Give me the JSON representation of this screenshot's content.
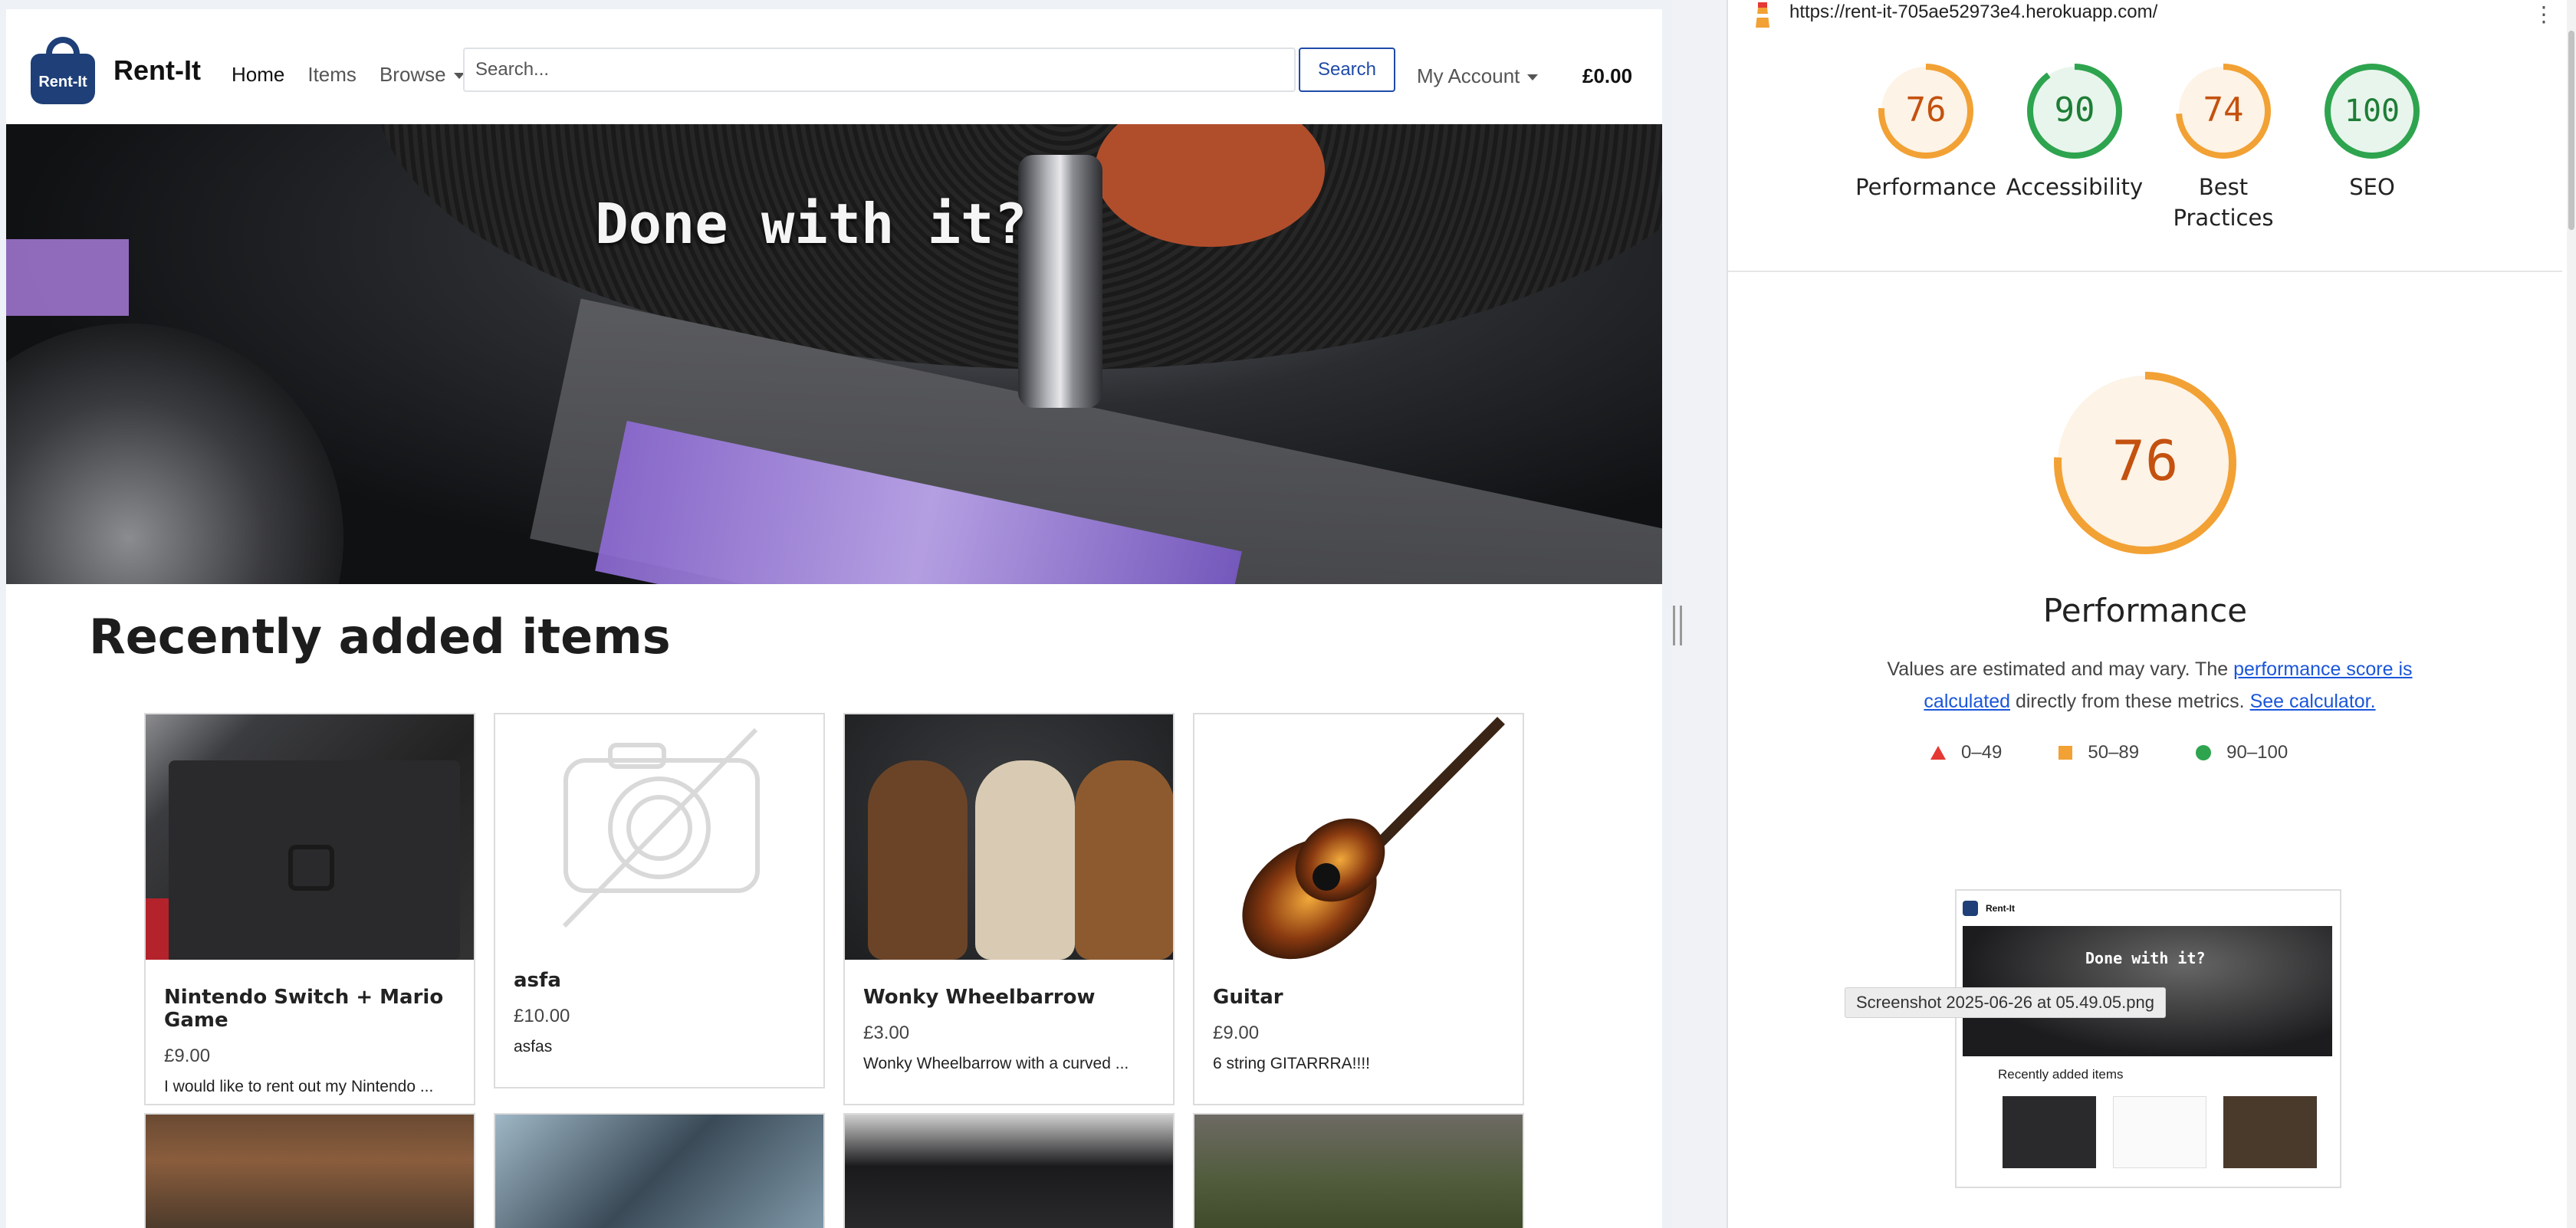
{
  "site": {
    "brand": {
      "logo_text": "Rent-It",
      "name": "Rent-It"
    },
    "nav": {
      "home": "Home",
      "items": "Items",
      "browse": "Browse"
    },
    "search": {
      "placeholder": "Search...",
      "button": "Search"
    },
    "account": "My Account",
    "cart_total": "£0.00",
    "hero_text": "Done with it?",
    "section_title": "Recently added items",
    "items": [
      {
        "name": "Nintendo Switch + Mario Game",
        "price": "£9.00",
        "desc": "I would like to rent out my Nintendo ..."
      },
      {
        "name": "asfa",
        "price": "£10.00",
        "desc": "asfas"
      },
      {
        "name": "Wonky Wheelbarrow",
        "price": "£3.00",
        "desc": "Wonky Wheelbarrow with a curved ..."
      },
      {
        "name": "Guitar",
        "price": "£9.00",
        "desc": "6 string GITARRRA!!!!"
      }
    ]
  },
  "lighthouse": {
    "url": "https://rent-it-705ae52973e4.herokuapp.com/",
    "scores": [
      {
        "label": "Performance",
        "value": "76",
        "color": "#f2a134",
        "fill": "#fdf3e6",
        "text": "#c4510f",
        "fraction": 0.76
      },
      {
        "label": "Accessibility",
        "value": "90",
        "color": "#2ea44f",
        "fill": "#e8f5ec",
        "text": "#1e7d36",
        "fraction": 0.9
      },
      {
        "label": "Best Practices",
        "value": "74",
        "color": "#f2a134",
        "fill": "#fdf3e6",
        "text": "#c4510f",
        "fraction": 0.74
      },
      {
        "label": "SEO",
        "value": "100",
        "color": "#2ea44f",
        "fill": "#e8f5ec",
        "text": "#1e7d36",
        "fraction": 1.0
      }
    ],
    "main": {
      "value": "76",
      "title": "Performance"
    },
    "note": {
      "prefix": "Values are estimated and may vary. The ",
      "link1": "performance score is calculated",
      "middle": " directly from these metrics. ",
      "link2": "See calculator."
    },
    "legend": {
      "fail": "0–49",
      "average": "50–89",
      "pass": "90–100"
    },
    "thumbnail": {
      "brand": "Rent-It",
      "hero_text": "Done with it?",
      "title": "Recently added items"
    },
    "tooltip": "Screenshot 2025-06-26 at 05.49.05.png"
  }
}
